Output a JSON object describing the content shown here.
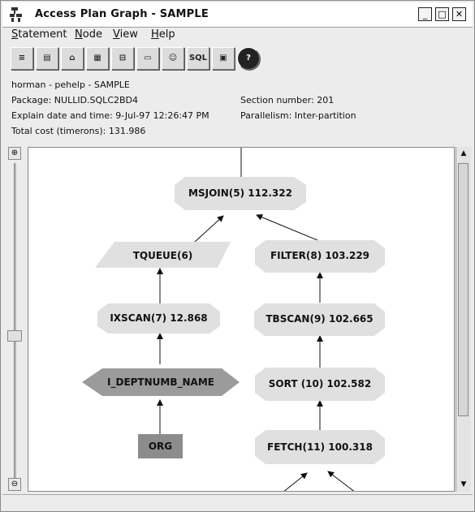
{
  "window": {
    "title": "Access Plan Graph - SAMPLE",
    "minimize_glyph": "_",
    "maximize_glyph": "□",
    "close_glyph": "✕"
  },
  "menu": [
    {
      "pre": "",
      "acc": "S",
      "rest": "tatement"
    },
    {
      "pre": "",
      "acc": "N",
      "rest": "ode"
    },
    {
      "pre": "",
      "acc": "V",
      "rest": "iew"
    },
    {
      "pre": "",
      "acc": "H",
      "rest": "elp"
    }
  ],
  "toolbar": [
    {
      "icon": "tree-icon",
      "glyph": "≡"
    },
    {
      "icon": "details-icon",
      "glyph": "▤"
    },
    {
      "icon": "open-icon",
      "glyph": "⌂"
    },
    {
      "icon": "grid-icon",
      "glyph": "▦"
    },
    {
      "icon": "settings-icon",
      "glyph": "⊟"
    },
    {
      "icon": "print-icon",
      "glyph": "▭"
    },
    {
      "icon": "person-icon",
      "glyph": "☺"
    },
    {
      "icon": "sql-icon",
      "glyph": "SQL"
    },
    {
      "icon": "package-icon",
      "glyph": "▣"
    },
    {
      "icon": "help-icon",
      "glyph": "?"
    }
  ],
  "info": {
    "user_line": "horman - pehelp - SAMPLE",
    "package": "Package: NULLID.SQLC2BD4",
    "explain_date": "Explain date and time: 9-Jul-97 12:26:47 PM",
    "total_cost": "Total cost (timerons): 131.986",
    "section_number": "Section number: 201",
    "parallelism": "Parallelism: Inter-partition"
  },
  "graph": {
    "nodes": [
      {
        "id": "msjoin",
        "label": "MSJOIN(5) 112.322",
        "shape": "octagon"
      },
      {
        "id": "tqueue",
        "label": "TQUEUE(6)",
        "shape": "parallelogram"
      },
      {
        "id": "filter",
        "label": "FILTER(8) 103.229",
        "shape": "octagon"
      },
      {
        "id": "ixscan",
        "label": "IXSCAN(7) 12.868",
        "shape": "octagon"
      },
      {
        "id": "tbscan",
        "label": "TBSCAN(9) 102.665",
        "shape": "octagon"
      },
      {
        "id": "index",
        "label": "I_DEPTNUMB_NAME",
        "shape": "hexagon"
      },
      {
        "id": "sort",
        "label": "SORT (10) 102.582",
        "shape": "octagon"
      },
      {
        "id": "org",
        "label": "ORG",
        "shape": "rect"
      },
      {
        "id": "fetch",
        "label": "FETCH(11) 100.318",
        "shape": "octagon"
      }
    ]
  },
  "colors": {
    "node_fill": "#e0e0e0",
    "index_fill": "#9b9b9b",
    "table_fill": "#8c8c8c"
  }
}
